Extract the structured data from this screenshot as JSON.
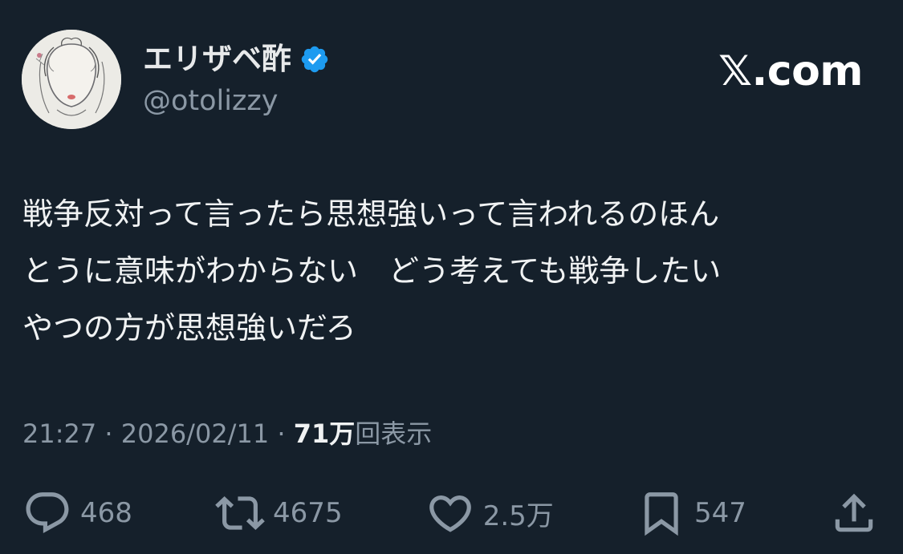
{
  "author": {
    "display_name": "エリザベ酢",
    "handle": "@otolizzy",
    "verified": true,
    "avatar_icon": "avatar-illustration"
  },
  "brand": "𝕏.com",
  "tweet": {
    "text": "戦争反対って言ったら思想強いって言われるのほん\nとうに意味がわからない　どう考えても戦争したい\nやつの方が思想強いだろ"
  },
  "meta": {
    "time": "21:27",
    "sep1": " · ",
    "date": "2026/02/11",
    "sep2": " · ",
    "views_count": "71万",
    "views_label": "回表示"
  },
  "actions": {
    "reply": {
      "icon": "reply-icon",
      "count": "468"
    },
    "repost": {
      "icon": "repost-icon",
      "count": "4675"
    },
    "like": {
      "icon": "heart-icon",
      "count": "2.5万"
    },
    "bookmark": {
      "icon": "bookmark-icon",
      "count": "547"
    },
    "share": {
      "icon": "share-icon"
    }
  },
  "colors": {
    "background": "#15202b",
    "text": "#e7e9ea",
    "secondary": "#8b98a5",
    "verified": "#1d9bf0"
  }
}
